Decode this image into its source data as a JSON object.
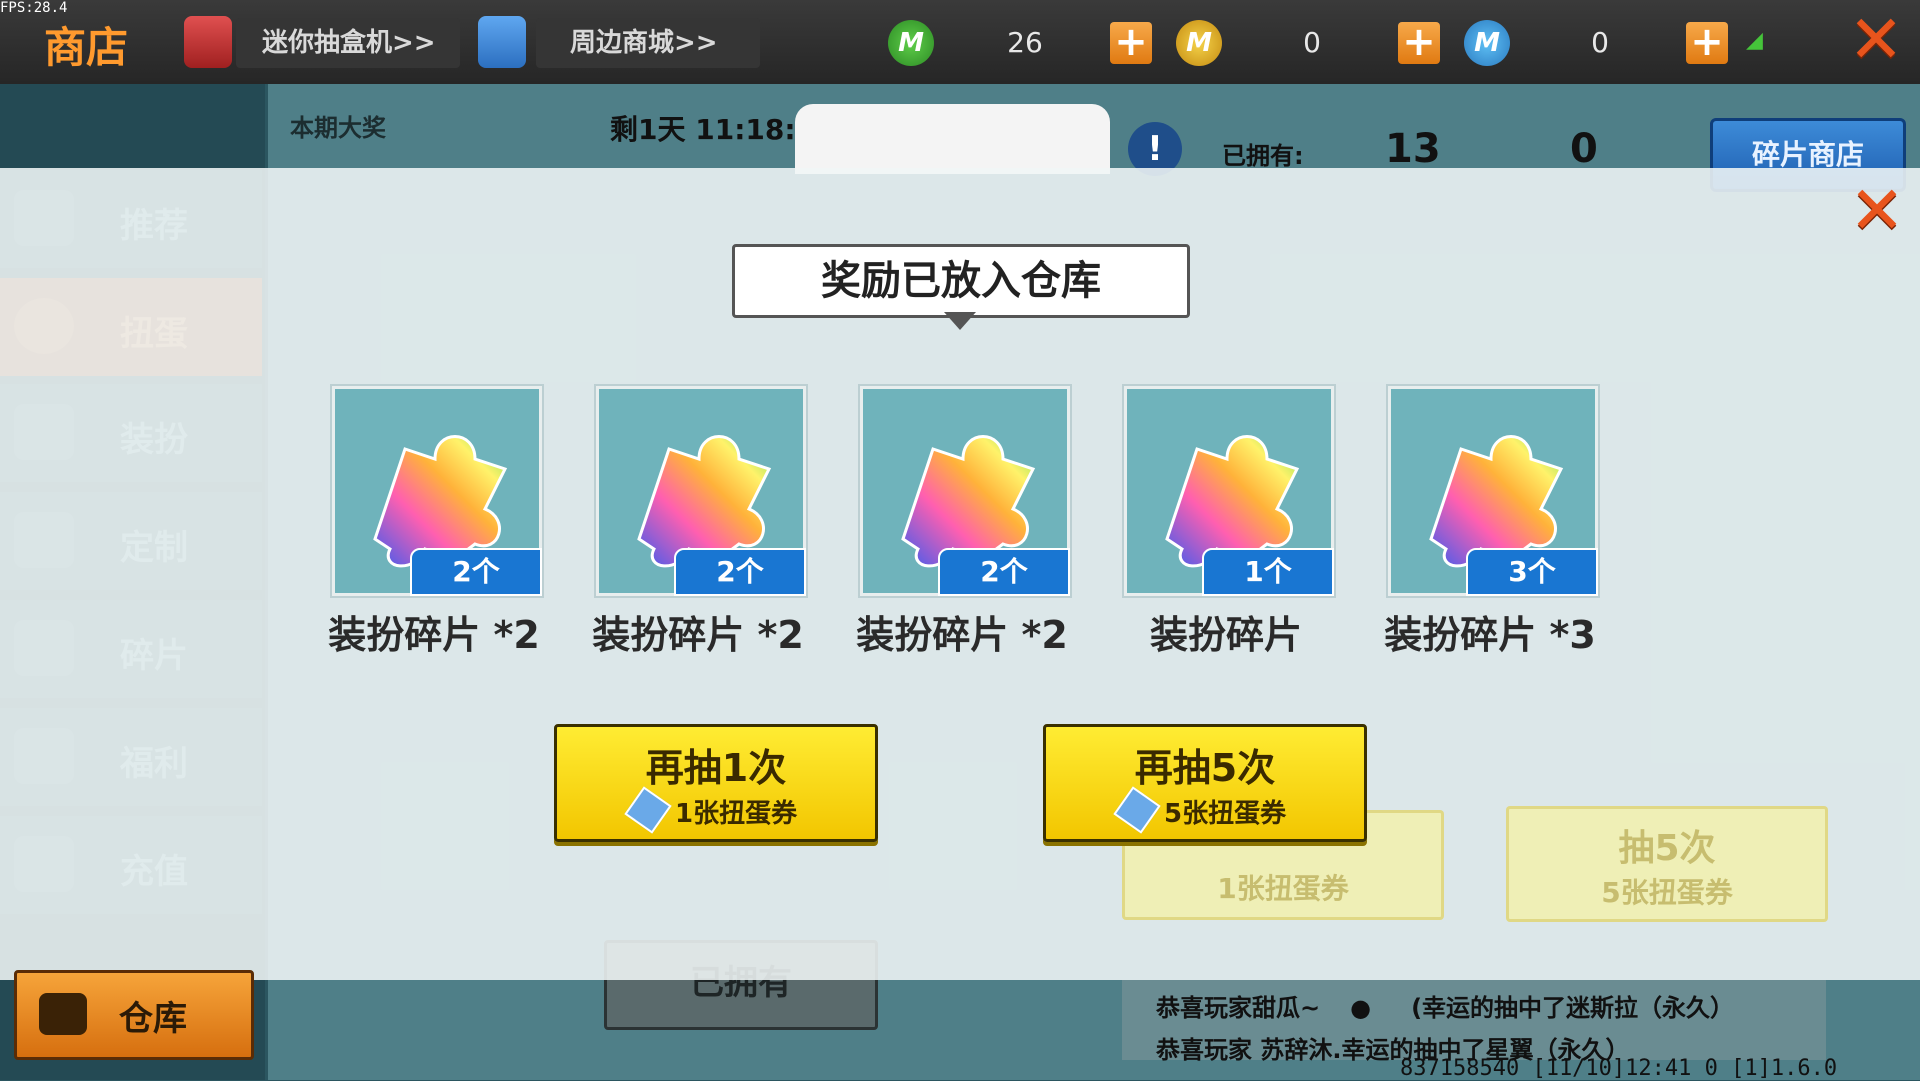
{
  "fps": "FPS:28.4",
  "header": {
    "title": "商店",
    "mini_gacha": "迷你抽盒机>>",
    "merch": "周边商城>>",
    "currency_1": "26",
    "currency_2": "0",
    "currency_3": "0"
  },
  "sidebar": {
    "items": [
      {
        "label": "推荐",
        "icon": "thumb-up-icon"
      },
      {
        "label": "扭蛋",
        "icon": "gacha-icon"
      },
      {
        "label": "装扮",
        "icon": "costume-icon"
      },
      {
        "label": "定制",
        "icon": "customize-icon"
      },
      {
        "label": "碎片",
        "icon": "fragment-icon"
      },
      {
        "label": "福利",
        "icon": "gift-icon"
      },
      {
        "label": "充值",
        "icon": "coins-icon"
      }
    ],
    "storage": "仓库"
  },
  "background": {
    "tab_title": "本期大奖",
    "timer": "剩1天 11:18:4",
    "owned_label": "已拥有:",
    "owned_fragments": "13",
    "owned_tickets": "0",
    "fragment_shop": "碎片商店",
    "owned_button": "已拥有",
    "bg_draw5": "抽5次",
    "bg_draw5_cost": "5张扭蛋券",
    "bg_draw1_cost": "1张扭蛋券",
    "feed_line1_a": "恭喜玩家甜瓜~",
    "feed_line1_b": "(幸运的抽中了迷斯拉（永久）",
    "feed_line2": "恭喜玩家   苏辞沐.幸运的抽中了星翼（永久）",
    "status": "837158540  [11/10]12:41 0  [1]1.6.0"
  },
  "modal": {
    "title": "奖励已放入仓库",
    "rewards": [
      {
        "badge": "2个",
        "label": "装扮碎片 *2"
      },
      {
        "badge": "2个",
        "label": "装扮碎片 *2"
      },
      {
        "badge": "2个",
        "label": "装扮碎片 *2"
      },
      {
        "badge": "1个",
        "label": "装扮碎片"
      },
      {
        "badge": "3个",
        "label": "装扮碎片 *3"
      }
    ],
    "draw1": {
      "label": "再抽1次",
      "cost": "1张扭蛋券"
    },
    "draw5": {
      "label": "再抽5次",
      "cost": "5张扭蛋券"
    }
  },
  "colors": {
    "accent_orange": "#ff9a2e",
    "button_yellow": "#f2c600",
    "badge_blue": "#1976d2",
    "close_red": "#e8541c"
  }
}
